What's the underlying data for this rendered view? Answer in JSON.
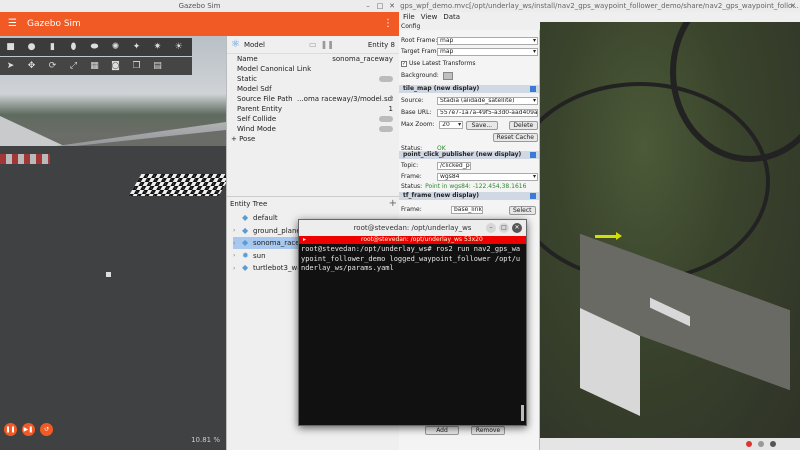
{
  "gazebo": {
    "window_title": "Gazebo Sim",
    "app_title": "Gazebo Sim",
    "fps_text": "10.81 %",
    "component": {
      "title": "Model",
      "entity_label": "Entity 8",
      "props": [
        {
          "key": "Name",
          "value": "sonoma_raceway"
        },
        {
          "key": "Model Canonical Link",
          "value": ""
        },
        {
          "key": "Static",
          "value": ""
        },
        {
          "key": "Model Sdf",
          "value": ""
        },
        {
          "key": "Source File Path",
          "value": "...oma raceway/3/model.sdf"
        },
        {
          "key": "Parent Entity",
          "value": "1"
        },
        {
          "key": "Self Collide",
          "value": ""
        },
        {
          "key": "Wind Mode",
          "value": ""
        }
      ],
      "pose_label": "+ Pose"
    },
    "entity_tree": {
      "title": "Entity Tree",
      "items": [
        "default",
        "ground_plane",
        "sonoma_raceway",
        "sun",
        "turtlebot3_waffle"
      ]
    }
  },
  "rviz": {
    "window_title": "gps_wpf_demo.mvc[/opt/underlay_ws/install/nav2_gps_waypoint_follower_demo/share/nav2_gps_waypoint_follo...",
    "menu": [
      "File",
      "View",
      "Data"
    ],
    "config_label": "Config",
    "global": {
      "root_frame_label": "Root Frame:",
      "root_frame": "map",
      "target_frame_label": "Target Frame:",
      "target_frame": "map",
      "latest_tf_label": "Use Latest Transforms",
      "background_label": "Background:"
    },
    "tile_map": {
      "header": "tile_map (new display)",
      "source_label": "Source:",
      "source": "Stadia (alidade_satellite)",
      "base_url_label": "Base URL:",
      "base_url": "557e7-1a7a-49f5-a3d0-aad409a11f33",
      "max_zoom_label": "Max Zoom:",
      "max_zoom": "20",
      "save_btn": "Save...",
      "delete_btn": "Delete",
      "reset_btn": "Reset Cache",
      "status_label": "Status:",
      "status": "OK"
    },
    "point_click": {
      "header": "point_click_publisher (new display)",
      "topic_label": "Topic:",
      "topic": "/clicked_point",
      "frame_label": "Frame:",
      "frame": "wgs84",
      "status_label": "Status:",
      "status": "Point in wgs84: -122.454,38.1616"
    },
    "tf_frame": {
      "header": "tf_frame (new display)",
      "frame_label": "Frame:",
      "frame": "base_link",
      "select_btn": "Select"
    },
    "add_btn": "Add",
    "remove_btn": "Remove"
  },
  "terminal": {
    "title": "root@stevedan: /opt/underlay_ws",
    "tab_text": "root@stevedan: /opt/underlay_ws 53x20",
    "body": "root@stevedan:/opt/underlay_ws# ros2 run nav2_gps_waypoint_follower_demo logged_waypoint_follower /opt/underlay_ws/params.yaml"
  },
  "colors": {
    "gazebo_orange": "#f15a24",
    "waypoint_arrow": "#d4e000",
    "status_ok": "#2a8a2a"
  }
}
